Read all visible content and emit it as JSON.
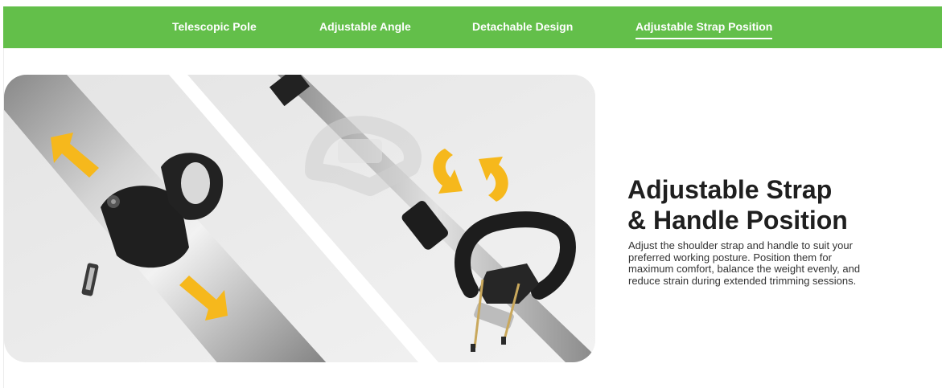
{
  "tabs": [
    {
      "label": "Telescopic Pole",
      "active": false
    },
    {
      "label": "Adjustable Angle",
      "active": false
    },
    {
      "label": "Detachable Design",
      "active": false
    },
    {
      "label": "Adjustable Strap Position",
      "active": true
    }
  ],
  "feature": {
    "title_line1": "Adjustable Strap",
    "title_line2": "& Handle Position",
    "description": "Adjust the shoulder strap and handle to suit your preferred working posture. Position them for maximum comfort, balance the weight evenly, and reduce strain during extended trimming sessions."
  },
  "colors": {
    "accent_green": "#63bf4a",
    "arrow_yellow": "#f6b81c",
    "title_text": "#1f1f1f",
    "body_text": "#333333"
  },
  "icons": [
    "double-arrow-icon",
    "rotate-arrows-icon"
  ]
}
